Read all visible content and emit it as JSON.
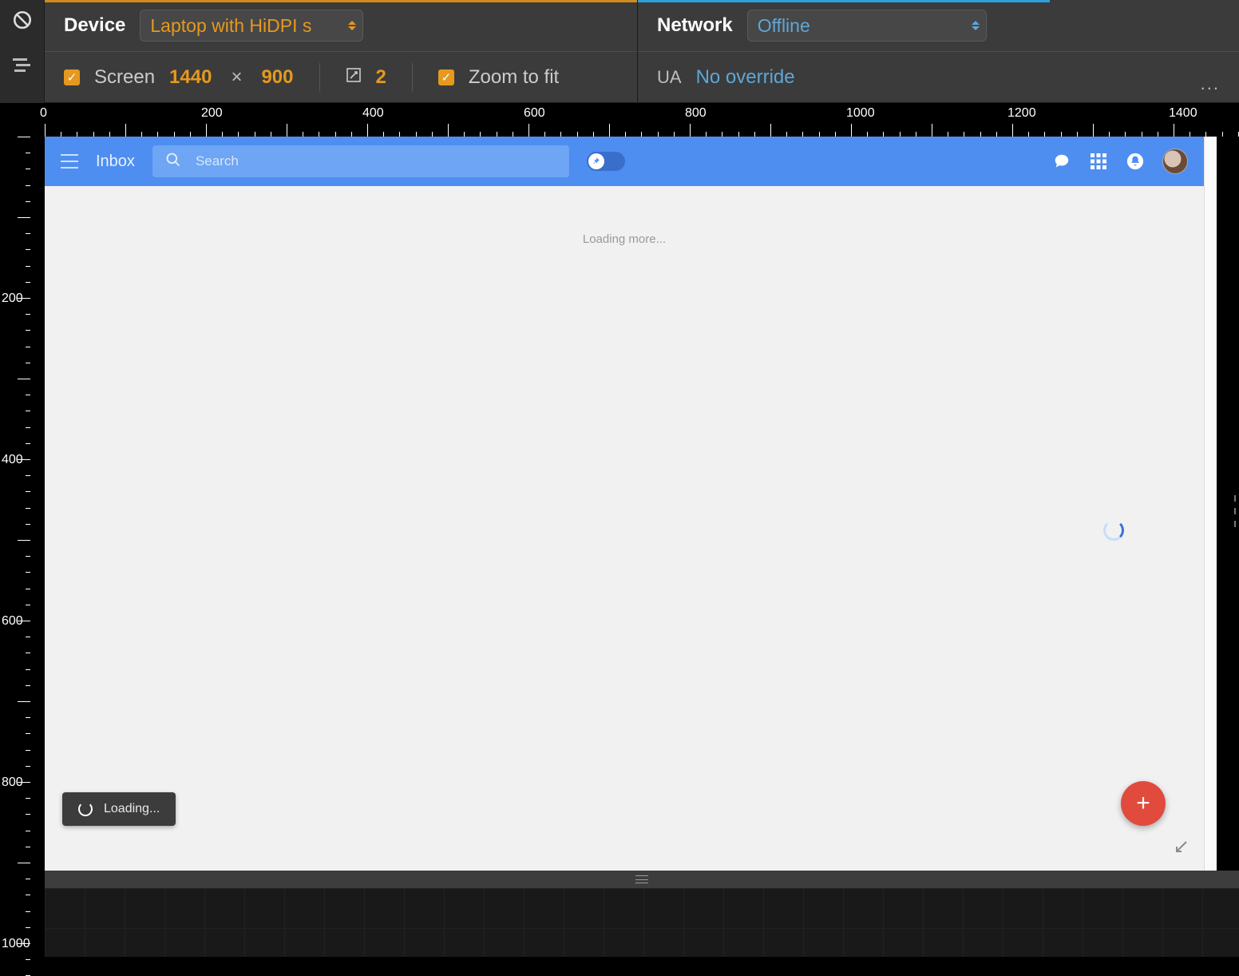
{
  "devtools": {
    "device_label": "Device",
    "device_value": "Laptop with HiDPI s",
    "network_label": "Network",
    "network_value": "Offline",
    "screen_label": "Screen",
    "width": "1440",
    "height": "900",
    "dpr": "2",
    "zoom_label": "Zoom to fit",
    "ua_label": "UA",
    "ua_value": "No override",
    "more": "..."
  },
  "ruler_h": [
    "0",
    "200",
    "400",
    "600",
    "800",
    "1000",
    "1200",
    "1400"
  ],
  "ruler_v": [
    "200",
    "400",
    "600",
    "800",
    "1000"
  ],
  "origin": "0",
  "inbox": {
    "title": "Inbox",
    "search_placeholder": "Search",
    "loading_more": "Loading more...",
    "toast": "Loading...",
    "fab": "+"
  }
}
